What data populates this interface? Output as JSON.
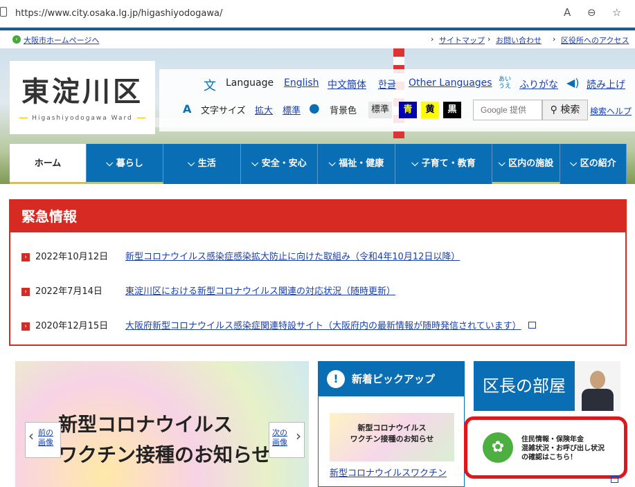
{
  "browser": {
    "url": "https://www.city.osaka.lg.jp/higashiyodogawa/"
  },
  "util": {
    "home_link": "大阪市ホームページへ",
    "sitemap": "サイトマップ",
    "contact": "お問い合わせ",
    "access": "区役所へのアクセス"
  },
  "logo": {
    "title": "東淀川区",
    "subtitle": "Higashiyodogawa Ward"
  },
  "lang": {
    "label": "Language",
    "english": "English",
    "chinese": "中文簡体",
    "korean": "한글",
    "other": "Other Languages",
    "furigana": "ふりがな",
    "readaloud": "読み上げ"
  },
  "text_size": {
    "label": "文字サイズ",
    "large": "拡大",
    "standard": "標準"
  },
  "bg_color": {
    "label": "背景色",
    "standard": "標準",
    "blue": "青",
    "yellow": "黄",
    "black": "黒"
  },
  "search": {
    "placeholder": "Google 提供",
    "button": "検索",
    "help": "検索ヘルプ"
  },
  "nav": [
    "ホーム",
    "暮らし",
    "生活",
    "安全・安心",
    "福祉・健康",
    "子育て・教育",
    "区内の施設",
    "区の紹介"
  ],
  "emergency": {
    "title": "緊急情報",
    "items": [
      {
        "date": "2022年10月12日",
        "text": "新型コロナウイルス感染症感染拡大防止に向けた取組み（令和4年10月12日以降）"
      },
      {
        "date": "2022年7月14日",
        "text": "東淀川区における新型コロナウイルス関連の対応状況（随時更新）"
      },
      {
        "date": "2020年12月15日",
        "text": "大阪府新型コロナウイルス感染症関連特設サイト（大阪府内の最新情報が随時発信されています）"
      }
    ]
  },
  "slider": {
    "caption_line1": "新型コロナウイルス",
    "caption_line2": "ワクチン接種のお知らせ",
    "prev": "前の画像",
    "next": "次の画像"
  },
  "pickup": {
    "title": "新着ピックアップ",
    "thumb_line1": "新型コロナウイルス",
    "thumb_line2": "ワクチン接種のお知らせ",
    "link": "新型コロナウイルスワクチン"
  },
  "mayor": {
    "title": "区長の部屋"
  },
  "banner": {
    "line1": "住民情報・保険年金",
    "line2": "混雑状況・お呼び出し状況",
    "line3": "の確認はこちら！"
  }
}
